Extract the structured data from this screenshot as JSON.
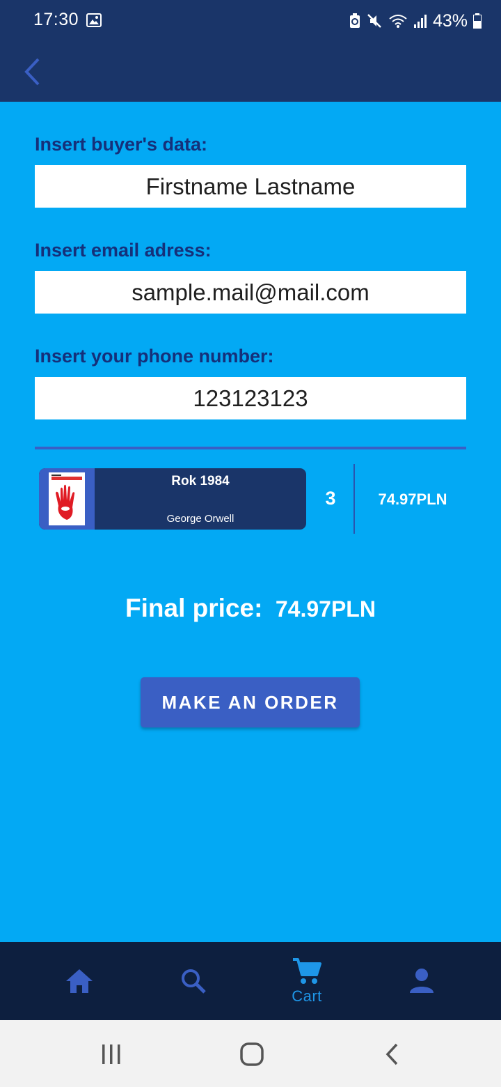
{
  "status_bar": {
    "time": "17:30",
    "battery": "43%",
    "icons": [
      "image-icon",
      "battery-saver-icon",
      "mute-icon",
      "wifi-icon",
      "signal-icon",
      "battery-icon"
    ]
  },
  "app_bar": {
    "back_icon": "chevron-left-icon"
  },
  "form": {
    "name_label": "Insert buyer's data:",
    "name_value": "Firstname Lastname",
    "email_label": "Insert email adress:",
    "email_value": "sample.mail@mail.com",
    "phone_label": "Insert your phone number:",
    "phone_value": "123123123"
  },
  "cart": {
    "items": [
      {
        "title": "Rok 1984",
        "author": "George Orwell",
        "quantity": "3",
        "price": "74.97PLN"
      }
    ]
  },
  "summary": {
    "final_price_label": "Final price:",
    "final_price_value": "74.97PLN"
  },
  "order_button": {
    "label": "MAKE AN ORDER"
  },
  "bottom_nav": {
    "items": [
      {
        "icon": "home-icon",
        "label": "",
        "active": false
      },
      {
        "icon": "search-icon",
        "label": "",
        "active": false
      },
      {
        "icon": "cart-icon",
        "label": "Cart",
        "active": true
      },
      {
        "icon": "account-icon",
        "label": "",
        "active": false
      }
    ]
  },
  "system_nav": {
    "icons": [
      "recents-icon",
      "home-circle-icon",
      "back-icon"
    ]
  },
  "colors": {
    "page_background": "#03a9f4",
    "app_bar": "#1a3569",
    "accent": "#3a5fc4",
    "label_text": "#15307a",
    "bottom_nav": "#0d1f3f",
    "nav_active": "#1e96e8"
  }
}
